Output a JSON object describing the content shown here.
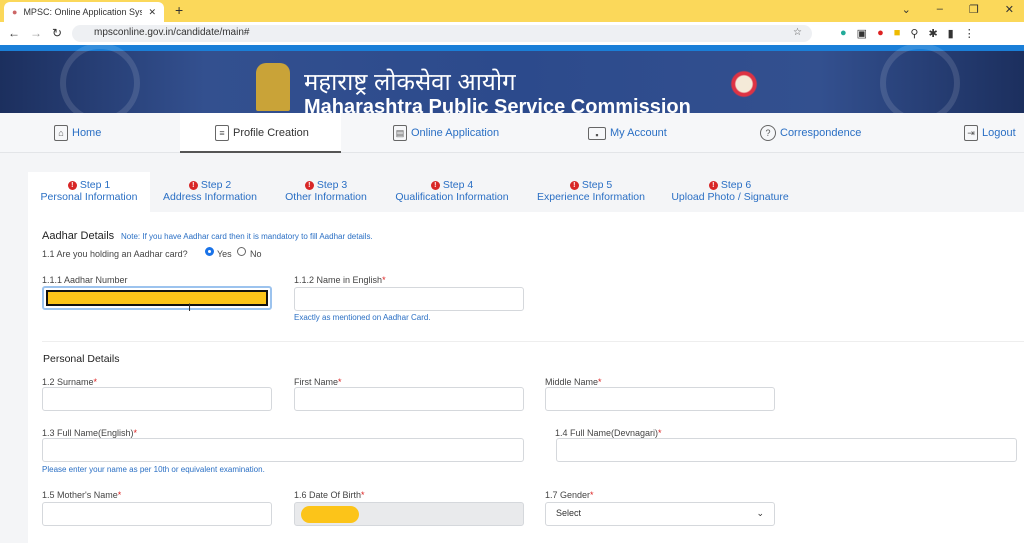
{
  "browser": {
    "tab_title": "MPSC: Online Application System",
    "url": "mpsconline.gov.in/candidate/main#"
  },
  "banner": {
    "title_marathi": "महाराष्ट्र लोकसेवा आयोग",
    "title_english": "Maharashtra Public Service Commission"
  },
  "nav": [
    {
      "label": "Home",
      "icon": "home-icon"
    },
    {
      "label": "Profile Creation",
      "icon": "document-icon",
      "active": true
    },
    {
      "label": "Online Application",
      "icon": "application-icon"
    },
    {
      "label": "My Account",
      "icon": "account-card-icon"
    },
    {
      "label": "Correspondence",
      "icon": "question-circle-icon"
    },
    {
      "label": "Logout",
      "icon": "logout-icon"
    }
  ],
  "steps": [
    {
      "step": "Step 1",
      "label": "Personal Information",
      "active": true
    },
    {
      "step": "Step 2",
      "label": "Address Information"
    },
    {
      "step": "Step 3",
      "label": "Other Information"
    },
    {
      "step": "Step 4",
      "label": "Qualification Information"
    },
    {
      "step": "Step 5",
      "label": "Experience Information"
    },
    {
      "step": "Step 6",
      "label": "Upload Photo / Signature"
    }
  ],
  "aadhar": {
    "heading": "Aadhar Details",
    "note": "Note: If you have Aadhar card then it is mandatory to fill Aadhar details.",
    "question": "1.1 Are you holding an Aadhar card?",
    "yes": "Yes",
    "no": "No",
    "selected": "Yes",
    "number_label": "1.1.1 Aadhar Number",
    "name_label": "1.1.2 Name in English",
    "name_hint": "Exactly as mentioned on Aadhar Card."
  },
  "personal": {
    "heading": "Personal Details",
    "surname": "1.2 Surname",
    "first": "First Name",
    "middle": "Middle Name",
    "full_en": "1.3 Full Name(English)",
    "full_dev": "1.4 Full Name(Devnagari)",
    "full_hint": "Please enter your name as per 10th or equivalent examination.",
    "mother": "1.5 Mother's Name",
    "dob": "1.6 Date Of Birth",
    "gender": "1.7 Gender",
    "gender_value": "Select"
  },
  "required_mark": "*",
  "colors": {
    "accent": "#2a6fc4",
    "banner": "#2c4a8c",
    "tabstrip": "#fbd85a",
    "required": "#d22222"
  }
}
